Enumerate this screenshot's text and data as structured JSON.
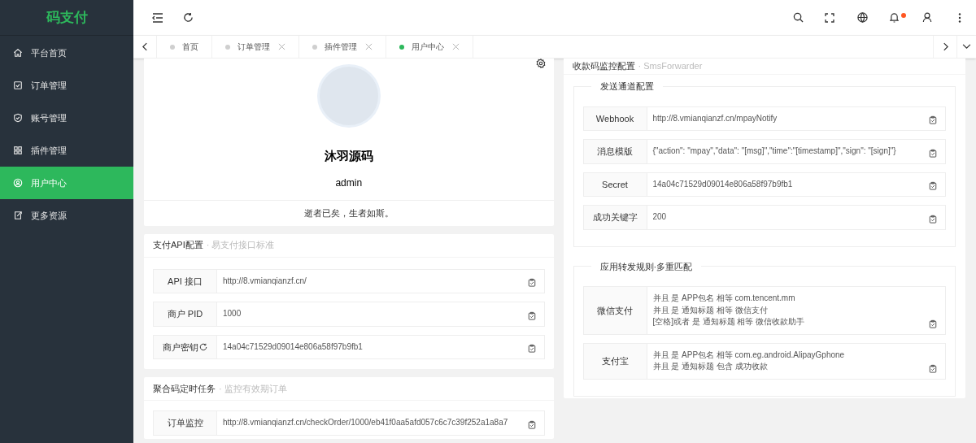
{
  "app": {
    "logo": "码支付"
  },
  "sidebar": {
    "items": [
      {
        "label": "平台首页",
        "kind": "home",
        "selected": false
      },
      {
        "label": "订单管理",
        "kind": "order",
        "selected": false
      },
      {
        "label": "账号管理",
        "kind": "shield",
        "selected": false
      },
      {
        "label": "插件管理",
        "kind": "grid",
        "selected": false
      },
      {
        "label": "用户中心",
        "kind": "user",
        "selected": true
      },
      {
        "label": "更多资源",
        "kind": "export",
        "selected": false
      }
    ]
  },
  "header": {
    "notification_dot": true
  },
  "tabs": [
    {
      "label": "首页",
      "closable": false,
      "selected": false
    },
    {
      "label": "订单管理",
      "closable": true,
      "selected": false
    },
    {
      "label": "插件管理",
      "closable": true,
      "selected": false
    },
    {
      "label": "用户中心",
      "closable": true,
      "selected": true
    }
  ],
  "profile": {
    "name": "沐羽源码",
    "username": "admin",
    "motto": "逝者已矣，生者如斯。"
  },
  "api_card": {
    "title": "支付API配置",
    "subtitle": "· 易支付接口标准",
    "fields": [
      {
        "label": "API 接口",
        "value": "http://8.vmianqianzf.cn/",
        "refresh": false
      },
      {
        "label": "商户 PID",
        "value": "1000",
        "refresh": false
      },
      {
        "label": "商户密钥",
        "value": "14a04c71529d09014e806a58f97b9fb1",
        "refresh": true
      }
    ]
  },
  "task_card": {
    "title": "聚合码定时任务",
    "subtitle": "· 监控有效期订单",
    "fields": [
      {
        "label": "订单监控",
        "value": "http://8.vmianqianzf.cn/checkOrder/1000/eb41f0aa5afd057c6c7c39f252a1a8a7",
        "refresh": false
      }
    ]
  },
  "monitor_card": {
    "title": "收款码监控配置",
    "subtitle": "· SmsForwarder",
    "groups": [
      {
        "legend": "发送通道配置",
        "fields": [
          {
            "label": "Webhook",
            "lines": [
              "http://8.vmianqianzf.cn/mpayNotify"
            ]
          },
          {
            "label": "消息模版",
            "lines": [
              "{\"action\": \"mpay\",\"data\": \"[msg]\",\"time\":\"[timestamp]\",\"sign\": \"[sign]\"}"
            ]
          },
          {
            "label": "Secret",
            "lines": [
              "14a04c71529d09014e806a58f97b9fb1"
            ]
          },
          {
            "label": "成功关键字",
            "lines": [
              "200"
            ]
          }
        ]
      },
      {
        "legend": "应用转发规则·多重匹配",
        "fields": [
          {
            "label": "微信支付",
            "lines": [
              "并且 是 APP包名 相等 com.tencent.mm",
              "并且 是 通知标题 相等 微信支付",
              "[空格]或者 是 通知标题 相等 微信收款助手"
            ]
          },
          {
            "label": "支付宝",
            "lines": [
              "并且 是 APP包名 相等 com.eg.android.AlipayGphone",
              "并且 是 通知标题 包含 成功收款"
            ]
          }
        ]
      }
    ]
  }
}
